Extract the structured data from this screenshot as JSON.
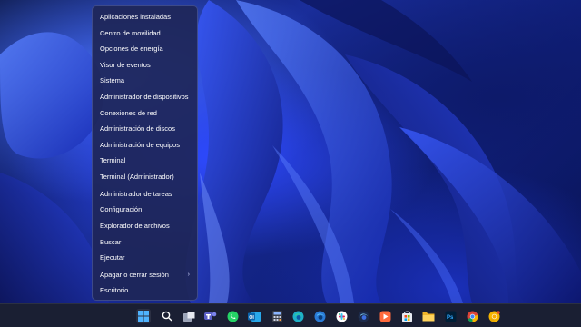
{
  "context_menu": {
    "items": [
      {
        "label": "Aplicaciones instaladas"
      },
      {
        "label": "Centro de movilidad"
      },
      {
        "label": "Opciones de energía"
      },
      {
        "label": "Visor de eventos"
      },
      {
        "label": "Sistema"
      },
      {
        "label": "Administrador de dispositivos"
      },
      {
        "label": "Conexiones de red"
      },
      {
        "label": "Administración de discos"
      },
      {
        "label": "Administración de equipos"
      },
      {
        "label": "Terminal"
      },
      {
        "label": "Terminal (Administrador)"
      },
      {
        "label": "Administrador de tareas"
      },
      {
        "label": "Configuración"
      },
      {
        "label": "Explorador de archivos"
      },
      {
        "label": "Buscar"
      },
      {
        "label": "Ejecutar"
      },
      {
        "label": "Apagar o cerrar sesión",
        "submenu_indicator": "›"
      },
      {
        "label": "Escritorio"
      }
    ]
  },
  "taskbar": {
    "icons": [
      {
        "name": "start-icon"
      },
      {
        "name": "search-icon"
      },
      {
        "name": "task-view-icon"
      },
      {
        "name": "teams-icon"
      },
      {
        "name": "whatsapp-icon"
      },
      {
        "name": "outlook-icon",
        "text": "Ol"
      },
      {
        "name": "calculator-icon"
      },
      {
        "name": "edge-icon"
      },
      {
        "name": "edge-beta-icon"
      },
      {
        "name": "slack-icon"
      },
      {
        "name": "edge-dev-icon"
      },
      {
        "name": "media-player-icon"
      },
      {
        "name": "store-icon"
      },
      {
        "name": "file-explorer-icon"
      },
      {
        "name": "photoshop-icon",
        "text": "Ps"
      },
      {
        "name": "chrome-icon"
      },
      {
        "name": "chrome-canary-icon"
      }
    ]
  },
  "colors": {
    "menu_background": "#1e2658",
    "taskbar_background": "#1a1f33",
    "wallpaper_accent": "#2d49ff"
  }
}
